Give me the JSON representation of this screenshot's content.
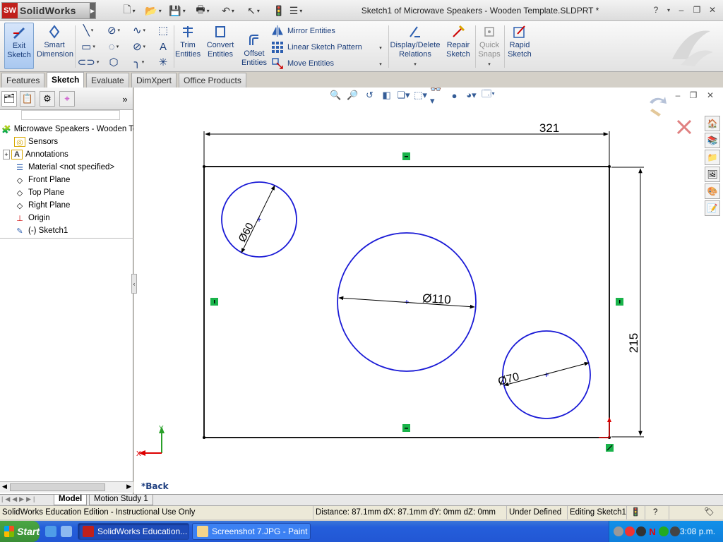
{
  "titlebar": {
    "app_name": "SolidWorks",
    "logo_badge": "SW",
    "document_title": "Sketch1 of Microwave Speakers - Wooden Template.SLDPRT *",
    "help": "?",
    "minimize": "–",
    "restore": "❐",
    "close": "✕"
  },
  "ribbon": {
    "exit_sketch": "Exit\nSketch",
    "smart_dimension": "Smart\nDimension",
    "trim_entities": "Trim\nEntities",
    "convert_entities": "Convert\nEntities",
    "offset_entities": "Offset\nEntities",
    "mirror_entities": "Mirror Entities",
    "linear_sketch_pattern": "Linear Sketch Pattern",
    "move_entities": "Move Entities",
    "display_delete_relations": "Display/Delete\nRelations",
    "repair_sketch": "Repair\nSketch",
    "quick_snaps": "Quick\nSnaps",
    "rapid_sketch": "Rapid\nSketch"
  },
  "tabs": {
    "features": "Features",
    "sketch": "Sketch",
    "evaluate": "Evaluate",
    "dimxpert": "DimXpert",
    "office_products": "Office Products"
  },
  "feature_tree": {
    "root": "Microwave Speakers - Wooden Template",
    "items": [
      {
        "label": "Sensors",
        "icon": "sensor-icon"
      },
      {
        "label": "Annotations",
        "icon": "annotations-icon"
      },
      {
        "label": "Material <not specified>",
        "icon": "material-icon"
      },
      {
        "label": "Front Plane",
        "icon": "plane-icon"
      },
      {
        "label": "Top Plane",
        "icon": "plane-icon"
      },
      {
        "label": "Right Plane",
        "icon": "plane-icon"
      },
      {
        "label": "Origin",
        "icon": "origin-icon"
      },
      {
        "label": "(-) Sketch1",
        "icon": "sketch-icon"
      }
    ],
    "expand_toggle": "+",
    "more": "»"
  },
  "sketch": {
    "dim_width": "321",
    "dim_height": "215",
    "dim_small_circle": "60",
    "dim_center_circle": "110",
    "dim_right_circle": "70",
    "diameter_symbol": "Ø",
    "view_label": "*Back",
    "axis_x": "X",
    "axis_y": "Y",
    "sketch_color": "#1a1ad6",
    "relation_color": "#19b34a"
  },
  "bottom_tabs": {
    "model": "Model",
    "motion_study": "Motion Study 1"
  },
  "status": {
    "edition": "SolidWorks Education Edition - Instructional Use Only",
    "measure": "Distance: 87.1mm  dX: 87.1mm  dY: 0mm  dZ: 0mm",
    "definition": "Under Defined",
    "mode": "Editing Sketch1"
  },
  "taskbar": {
    "start": "Start",
    "task1": "SolidWorks Education...",
    "task2": "Screenshot 7.JPG - Paint",
    "clock": "3:08 p.m.",
    "tray_n": "N"
  }
}
